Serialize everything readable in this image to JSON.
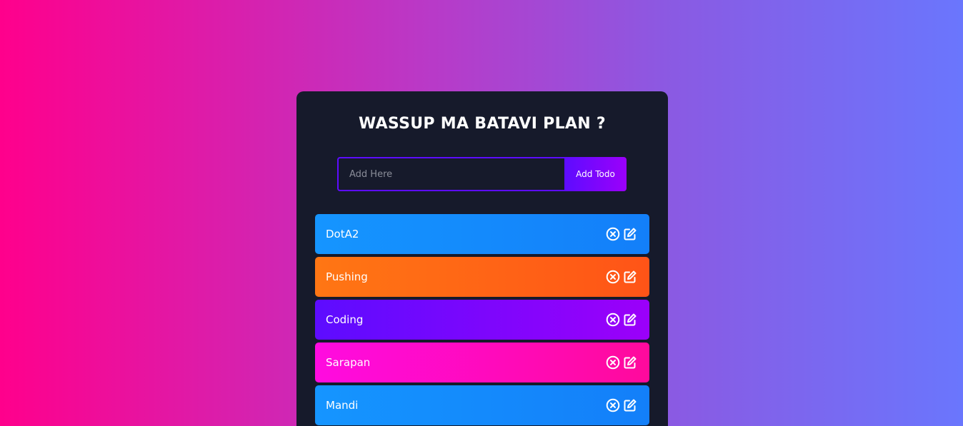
{
  "header": {
    "title": "WASSUP MA BATAVI PLAN ?"
  },
  "form": {
    "input_value": "",
    "input_placeholder": "Add Here",
    "add_button_label": "Add Todo"
  },
  "todos": [
    {
      "text": "DotA2",
      "color": "#1595ff",
      "delete_icon": "close-circle-icon",
      "edit_icon": "edit-icon"
    },
    {
      "text": "Pushing",
      "color": "#ff7614",
      "delete_icon": "close-circle-icon",
      "edit_icon": "edit-icon"
    },
    {
      "text": "Coding",
      "color": "#5d0cff",
      "delete_icon": "close-circle-icon",
      "edit_icon": "edit-icon"
    },
    {
      "text": "Sarapan",
      "color": "#ff0be0",
      "delete_icon": "close-circle-icon",
      "edit_icon": "edit-icon"
    },
    {
      "text": "Mandi",
      "color": "#1595ff",
      "delete_icon": "close-circle-icon",
      "edit_icon": "edit-icon"
    }
  ],
  "theme": {
    "card_background": "#161a2b",
    "accent": "#5d0cff",
    "page_gradient_start": "#ff008c",
    "page_gradient_end": "#6a76fd"
  }
}
